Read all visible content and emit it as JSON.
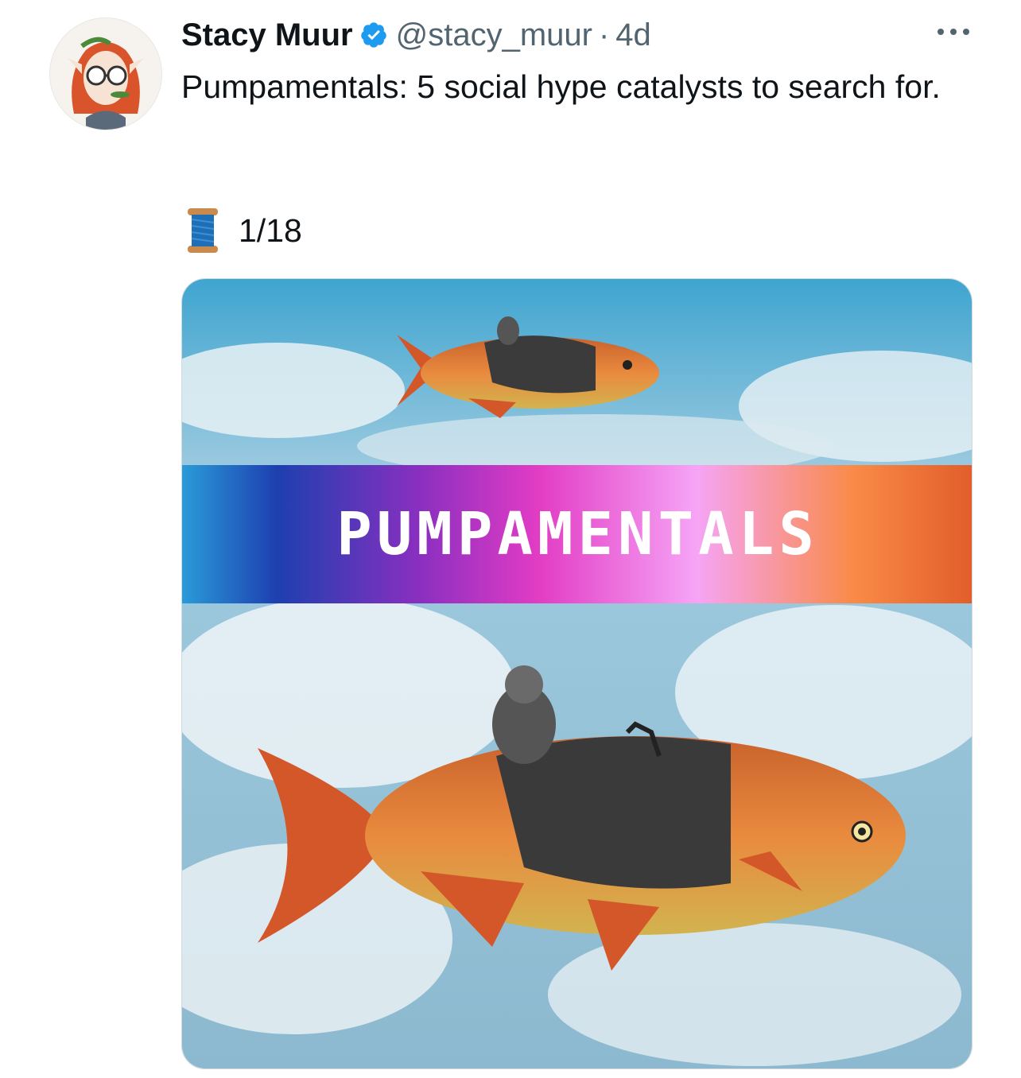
{
  "tweet": {
    "author": {
      "display_name": "Stacy Muur",
      "handle": "@stacy_muur",
      "verified": true,
      "avatar_icon": "avatar-elf-with-glasses"
    },
    "separator": "·",
    "time": "4d",
    "text": "Pumpamentals: 5 social hype catalysts to search for.",
    "thread": {
      "emoji": "spool-of-thread-icon",
      "count": "1/18"
    },
    "media": {
      "banner_text": "PUMPAMENTALS",
      "description_icon": "flying-fish-pilot-image"
    }
  },
  "colors": {
    "text_primary": "#0f1419",
    "text_secondary": "#536471",
    "verified_blue": "#1d9bf0"
  },
  "icons": {
    "more": "more-horizontal-icon",
    "verified": "verified-badge-icon"
  }
}
